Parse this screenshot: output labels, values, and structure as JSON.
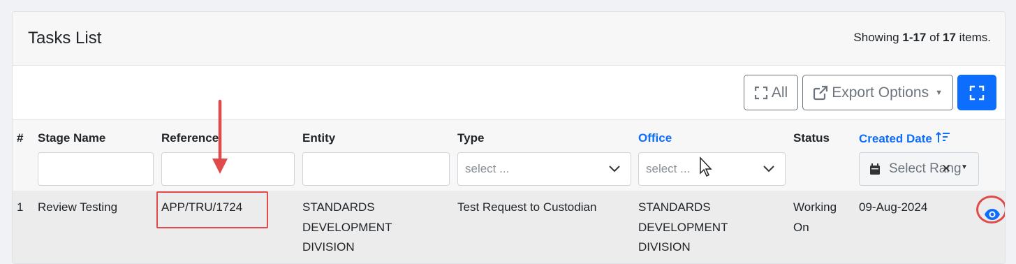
{
  "header": {
    "title": "Tasks List",
    "summary_prefix": "Showing ",
    "summary_range": "1-17",
    "summary_of": " of ",
    "summary_total": "17",
    "summary_suffix": " items."
  },
  "toolbar": {
    "all_label": "All",
    "export_label": "Export Options"
  },
  "columns": {
    "index": "#",
    "stage_name": "Stage Name",
    "reference": "Reference",
    "entity": "Entity",
    "type": "Type",
    "office": "Office",
    "status": "Status",
    "created_date": "Created Date"
  },
  "filters": {
    "type_placeholder": "select ...",
    "office_placeholder": "select ...",
    "date_placeholder": "Select Rang"
  },
  "rows": [
    {
      "index": "1",
      "stage_name": "Review Testing",
      "reference": "APP/TRU/1724",
      "entity": "STANDARDS DEVELOPMENT DIVISION",
      "type": "Test Request to Custodian",
      "office": "STANDARDS DEVELOPMENT DIVISION",
      "status": "Working On",
      "created_date": "09-Aug-2024"
    }
  ],
  "colors": {
    "primary": "#0d6efd",
    "annotation": "#e04a4a",
    "header_bg": "#f7f7f7",
    "row_bg": "#ececec"
  },
  "icons": {
    "all": "expand-icon",
    "export": "external-link-icon",
    "fullscreen": "fullscreen-icon",
    "sort": "sort-ascending-icon",
    "calendar": "calendar-icon",
    "clear": "close-icon",
    "view": "eye-icon"
  }
}
